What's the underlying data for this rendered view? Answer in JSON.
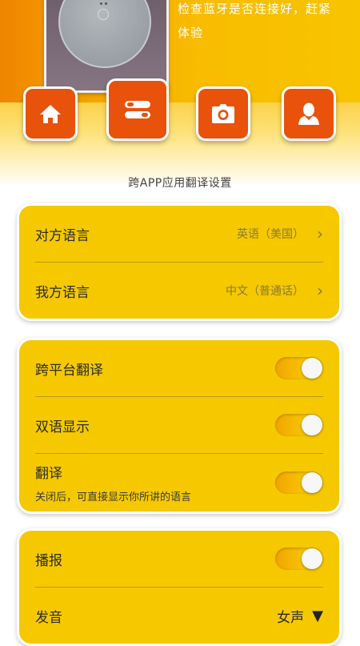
{
  "hero": {
    "text_line1": "检查蓝牙是否连接好，赶紧",
    "text_line2": "体验"
  },
  "nav": {
    "items": [
      {
        "name": "home",
        "icon": "home-icon",
        "active": false
      },
      {
        "name": "settings",
        "icon": "toggles-icon",
        "active": true
      },
      {
        "name": "camera",
        "icon": "camera-icon",
        "active": false
      },
      {
        "name": "profile",
        "icon": "user-icon",
        "active": false
      }
    ]
  },
  "caption": "跨APP应用翻译设置",
  "languages": {
    "other_label": "对方语言",
    "other_value": "英语（美国）",
    "mine_label": "我方语言",
    "mine_value": "中文（普通话）"
  },
  "options": {
    "cross_platform_label": "跨平台翻译",
    "cross_platform_on": true,
    "bilingual_label": "双语显示",
    "bilingual_on": true,
    "translate_label": "翻译",
    "translate_sub": "关闭后，可直接显示你所讲的语言",
    "translate_on": true
  },
  "broadcast": {
    "broadcast_label": "播报",
    "broadcast_on": true,
    "voice_label": "发音",
    "voice_value": "女声",
    "voice_arrow": "▼"
  },
  "colors": {
    "accent_orange": "#e8520a",
    "card_yellow": "#f5c800"
  }
}
